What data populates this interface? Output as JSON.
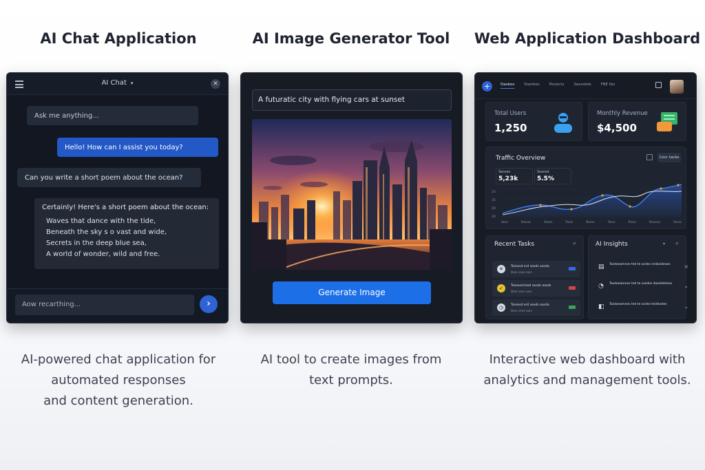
{
  "titles": {
    "chat": "AI Chat Application",
    "image": "AI Image Generator Tool",
    "dashboard": "Web Application Dashboard"
  },
  "captions": {
    "chat": [
      "AI-powered chat application for",
      "automated responses",
      "and content generation."
    ],
    "image": [
      "AI tool to create images from",
      "text prompts."
    ],
    "dashboard": [
      "Interactive web dashboard with",
      "analytics and management tools."
    ]
  },
  "chat": {
    "title": "AI Chat",
    "messages": {
      "m1": "Ask me anything...",
      "m2": "Hello! How can I assist you today?",
      "m3": "Can you write a short poem about the ocean?",
      "m4_intro": "Certainly! Here's a short poem about the ocean:",
      "poem": [
        "Waves that dance with the tide,",
        "Beneath the sky s o vast and wide,",
        "Secrets in the deep blue sea,",
        "A world of wonder, wild and free."
      ]
    },
    "input_placeholder": "Aow recarthing..."
  },
  "image_tool": {
    "prompt": "A futuratic city with flying cars at sunset",
    "button": "Generate Image"
  },
  "dashboard": {
    "nav": [
      "Dasbos",
      "Dasrbes",
      "Porjects",
      "Seosrbds",
      "FBE tbs"
    ],
    "total_users_label": "Total Users",
    "total_users": "1,250",
    "revenue_label": "Monthly Revenue",
    "revenue": "$4,500",
    "traffic_title": "Traffic Overview",
    "traffic_btn": "Cecr tacks",
    "traffic_stat1_label": "Sesses",
    "traffic_stat1": "5,23k",
    "traffic_stat2_label": "Soored",
    "traffic_stat2": "5.5%",
    "x_ticks": [
      "Aess",
      "Rasses",
      "Seoss",
      "Tesss",
      "Boess",
      "Tesss",
      "Riess",
      "Sessess",
      "Sesss"
    ],
    "y_ticks": [
      "23",
      "25",
      "20",
      "10"
    ],
    "recent_tasks_title": "Recent Tasks",
    "ai_insights_title": "AI Insights",
    "tasks": [
      {
        "t1": "Tsesesd erd seods asoda",
        "t2": "Desc ones sass",
        "tag": "#2f6fe0",
        "icon": "#d7dce4",
        "glyph": "✕"
      },
      {
        "t1": "Tosesed teed seods asods",
        "t2": "Desc ones sass",
        "tag": "#d64545",
        "icon": "#e6c230",
        "glyph": "✓"
      },
      {
        "t1": "Tsesesd erd seods asoda",
        "t2": "Desc ones sass",
        "tag": "#35a853",
        "icon": "#d7dce4",
        "glyph": "◷"
      }
    ],
    "insights": [
      {
        "t": "Tasdoeamnes ted te acdes redasideaos",
        "icon": "▤"
      },
      {
        "t": "Tasdoeamnes ted te ssedes daaddetoies",
        "icon": "◔"
      },
      {
        "t": "Tasdoeamnes ted te acdes tedstodes",
        "icon": "◧"
      }
    ],
    "colors": {
      "accent": "#2e63d6",
      "chart_line_1": "#3b82f6",
      "chart_line_2": "#e6ecf5",
      "points": "#f29a3a"
    }
  }
}
